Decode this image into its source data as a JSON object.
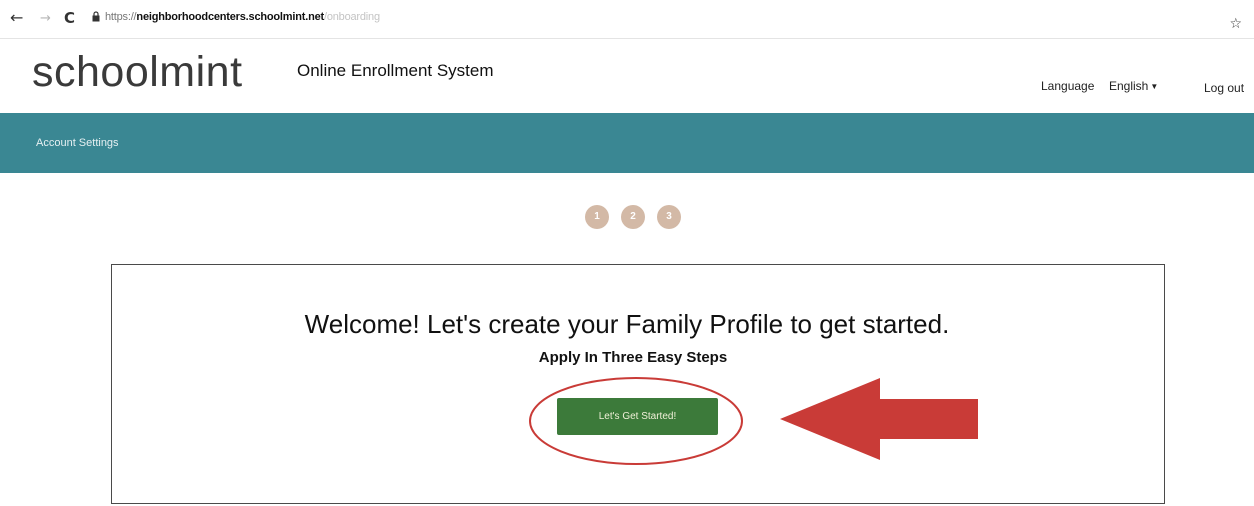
{
  "browser": {
    "url_scheme": "https://",
    "url_host": "neighborhoodcenters.schoolmint.net",
    "url_path": "/onboarding"
  },
  "header": {
    "logo_text": "schoolmint",
    "app_title": "Online Enrollment System",
    "language_label": "Language",
    "language_value": "English",
    "logout_label": "Log out"
  },
  "navbar": {
    "account_settings_label": "Account Settings"
  },
  "stepper": {
    "steps": [
      "1",
      "2",
      "3"
    ]
  },
  "main": {
    "title": "Welcome! Let's create your Family Profile to get started.",
    "subtitle": "Apply In Three Easy Steps",
    "start_button_label": "Let's Get Started!"
  },
  "colors": {
    "navbar": "#3a8793",
    "button": "#3c7a3a",
    "step": "#d3b9a6",
    "annotation": "#c93b37"
  },
  "icons": {
    "back": "arrow-left-icon",
    "forward": "arrow-right-icon",
    "reload": "reload-icon",
    "lock": "lock-icon",
    "bookmark": "star-icon"
  }
}
